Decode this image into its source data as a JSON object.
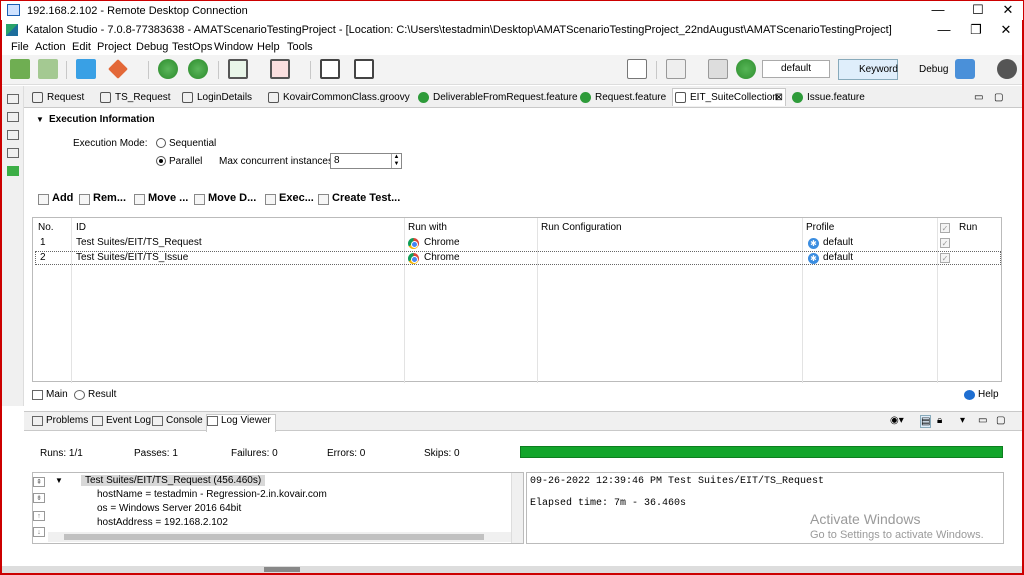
{
  "rdp": {
    "title": "192.168.2.102 - Remote Desktop Connection",
    "min": "—",
    "max": "☐",
    "close": "✕"
  },
  "app": {
    "title": "Katalon Studio - 7.0.8-77383638 - AMATScenarioTestingProject - [Location: C:\\Users\\testadmin\\Desktop\\AMATScenarioTestingProject_22ndAugust\\AMATScenarioTestingProject]",
    "min": "—",
    "restore": "❐",
    "close": "✕"
  },
  "menu": [
    "File",
    "Action",
    "Edit",
    "Project",
    "Debug",
    "TestOps",
    "Window",
    "Help",
    "Tools"
  ],
  "toolbar": {
    "profile_combo": "default",
    "keyword_label": "Keyword",
    "debug_label": "Debug"
  },
  "tabs": [
    {
      "label": "Request",
      "color": "#555555"
    },
    {
      "label": "TS_Request",
      "color": "#555555"
    },
    {
      "label": "LoginDetails",
      "color": "#555555"
    },
    {
      "label": "KovairCommonClass.groovy",
      "color": "#555555"
    },
    {
      "label": "DeliverableFromRequest.feature",
      "color": "#2e9b3a"
    },
    {
      "label": "Request.feature",
      "color": "#2e9b3a"
    },
    {
      "label": "EIT_SuiteCollection",
      "color": "#555555"
    },
    {
      "label": "Issue.feature",
      "color": "#2e9b3a"
    }
  ],
  "execution": {
    "section_title": "Execution Information",
    "mode_label": "Execution Mode:",
    "sequential": "Sequential",
    "parallel": "Parallel",
    "max_label": "Max concurrent instances:",
    "max_value": "8"
  },
  "editor_toolbar": {
    "add": "Add",
    "remove": "Rem...",
    "move_up": "Move ...",
    "move_down": "Move D...",
    "execute": "Exec...",
    "create": "Create Test..."
  },
  "table": {
    "headers": {
      "no": "No.",
      "id": "ID",
      "run_with": "Run with",
      "run_config": "Run Configuration",
      "profile": "Profile",
      "run": "Run"
    },
    "rows": [
      {
        "no": "1",
        "id": "Test Suites/EIT/TS_Request",
        "run_with": "Chrome",
        "run_config": "",
        "profile": "default",
        "run": true
      },
      {
        "no": "2",
        "id": "Test Suites/EIT/TS_Issue",
        "run_with": "Chrome",
        "run_config": "",
        "profile": "default",
        "run": true
      }
    ]
  },
  "bottom_tabs": {
    "main": "Main",
    "result": "Result",
    "help": "Help"
  },
  "lower_tabs": [
    "Problems",
    "Event Log",
    "Console",
    "Log Viewer"
  ],
  "stats": {
    "runs": "Runs:  1/1",
    "passes": "Passes:  1",
    "failures": "Failures:  0",
    "errors": "Errors:  0",
    "skips": "Skips:  0",
    "progress": 1.0
  },
  "log_tree": [
    "Test Suites/EIT/TS_Request (456.460s)",
    "hostName = testadmin - Regression-2.in.kovair.com",
    "os = Windows Server 2016 64bit",
    "hostAddress = 192.168.2.102"
  ],
  "log_view": [
    "09-26-2022 12:39:46 PM Test Suites/EIT/TS_Request",
    "Elapsed time: 7m - 36.460s"
  ],
  "watermark": {
    "line1": "Activate Windows",
    "line2": "Go to Settings to activate Windows."
  }
}
